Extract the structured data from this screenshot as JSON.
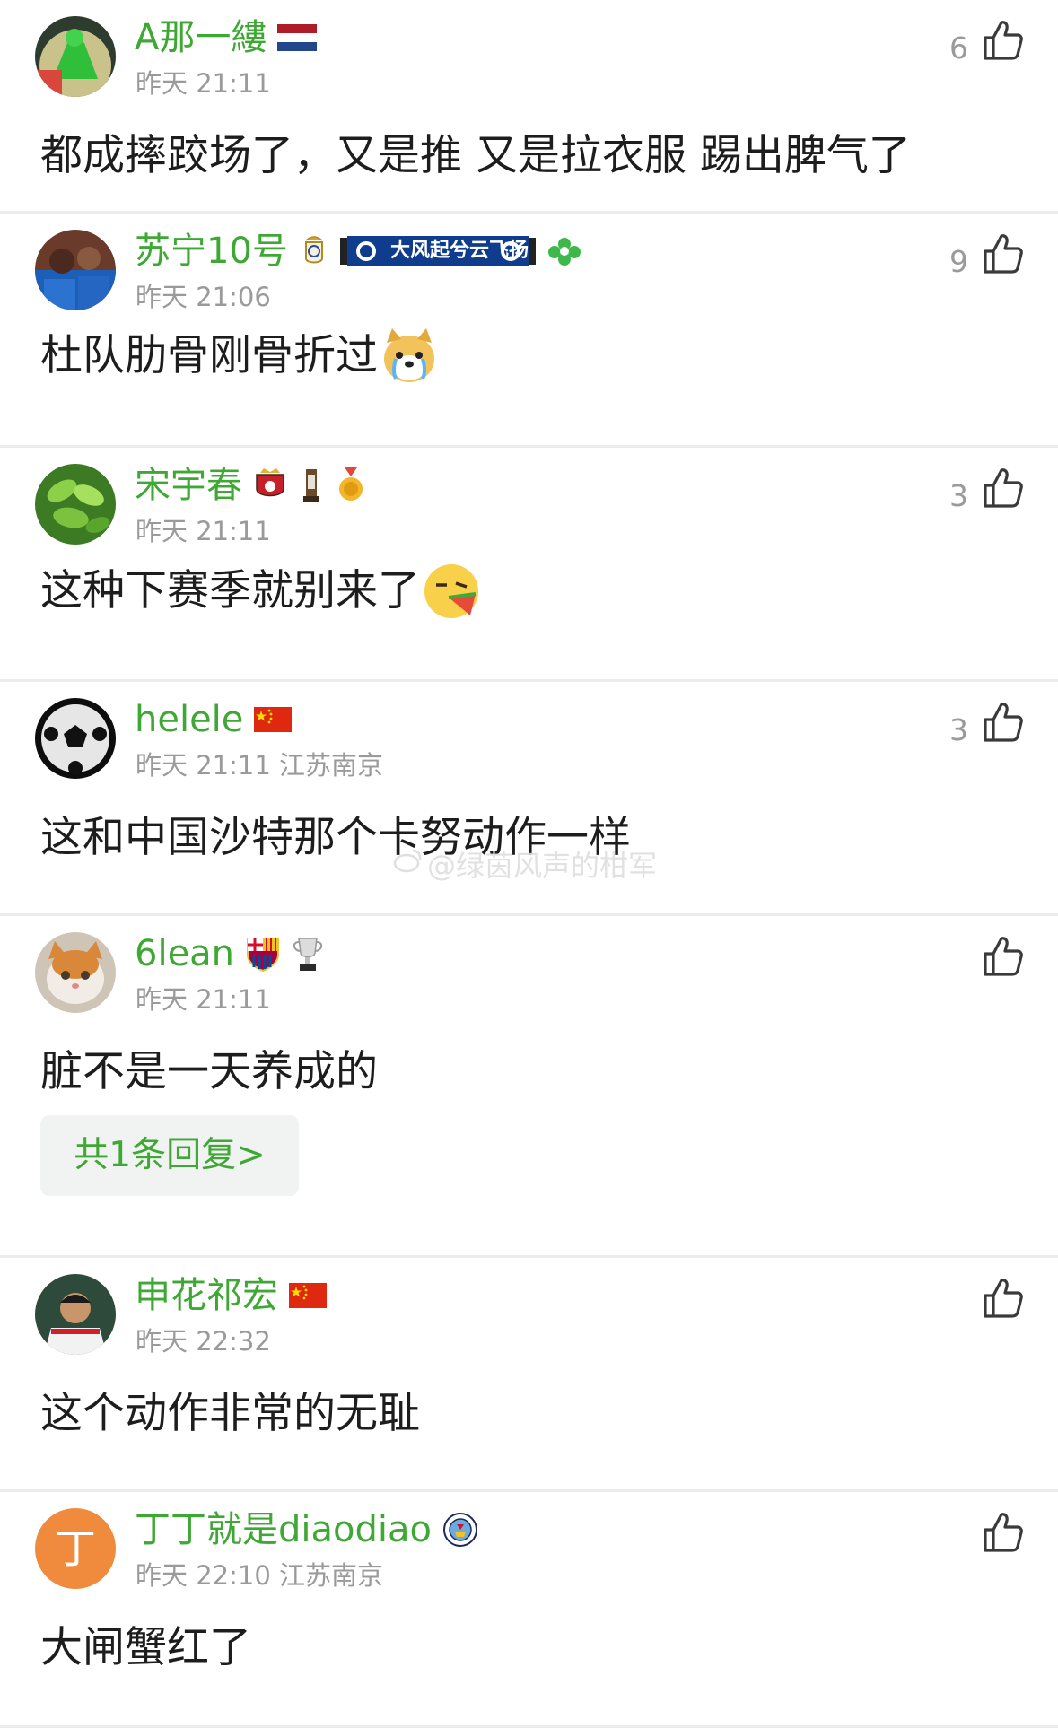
{
  "comments": [
    {
      "username": "A那一縷",
      "time": "昨天 21:11",
      "likes": "6",
      "text": "都成摔跤场了，又是推 又是拉衣服 踢出脾气了",
      "badges": [
        "netherlands-flag"
      ],
      "avatar": "green-figure-avatar"
    },
    {
      "username": "苏宁10号",
      "time": "昨天 21:06",
      "likes": "9",
      "text": "杜队肋骨刚骨折过",
      "badge_scarf_text": "大风起兮云飞扬",
      "badges": [
        "real-madrid-crest",
        "club-scarf",
        "green-flower-badge"
      ],
      "emoji": "crying-dog-emoji",
      "avatar": "players-photo-avatar"
    },
    {
      "username": "宋宇春",
      "time": "昨天 21:11",
      "likes": "3",
      "text": "这种下赛季就别来了",
      "badges": [
        "shanghai-port-crest",
        "trophy-badge",
        "gold-medal-badge"
      ],
      "emoji": "eating-watermelon-emoji",
      "avatar": "green-leaves-avatar"
    },
    {
      "username": "helele",
      "time": "昨天 21:11 江苏南京",
      "likes": "3",
      "text": "这和中国沙特那个卡努动作一样",
      "badges": [
        "china-flag"
      ],
      "avatar": "soccer-ball-avatar"
    },
    {
      "username": "6lean",
      "time": "昨天 21:11",
      "likes": "",
      "text": "脏不是一天养成的",
      "reply_label": "共1条回复>",
      "badges": [
        "barcelona-crest",
        "cup-trophy-badge"
      ],
      "avatar": "cat-avatar"
    },
    {
      "username": "申花祁宏",
      "time": "昨天 22:32",
      "likes": "",
      "text": "这个动作非常的无耻",
      "badges": [
        "china-flag"
      ],
      "avatar": "player-photo-avatar"
    },
    {
      "username": "丁丁就是diaodiao",
      "time": "昨天 22:10 江苏南京",
      "likes": "",
      "text": "大闸蟹红了",
      "avatar_letter": "丁",
      "badges": [
        "man-city-crest"
      ],
      "avatar": "letter-avatar"
    }
  ],
  "watermark": "@绿茵风声的柑军",
  "colors": {
    "username_green": "#3fa835",
    "meta_gray": "#9a9a9a",
    "divider": "#ececec",
    "reply_bg": "#f0f3f2",
    "letter_avatar_orange": "#f08a3c"
  }
}
